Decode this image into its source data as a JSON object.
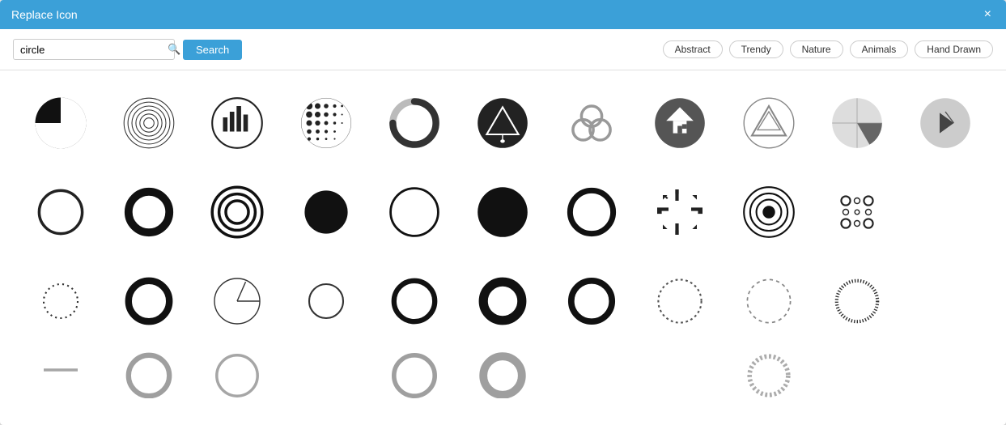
{
  "dialog": {
    "title": "Replace Icon",
    "close_label": "×"
  },
  "toolbar": {
    "search_value": "circle",
    "search_placeholder": "circle",
    "search_button_label": "Search",
    "tags": [
      "Abstract",
      "Trendy",
      "Nature",
      "Animals",
      "Hand Drawn"
    ]
  },
  "icons": {
    "rows": [
      [
        "pie-segments-circle",
        "concentric-lines-circle",
        "bar-chart-circle",
        "halftone-dots-circle",
        "arc-circle",
        "triangle-in-circle",
        "trefoil-knot-circle",
        "house-in-circle",
        "triangle-outline-in-circle",
        "sector-circle"
      ],
      [
        "thin-ring",
        "bold-ring",
        "triple-ring",
        "solid-disc",
        "outline-circle",
        "solid-circle",
        "bold-outline-circle",
        "target-crosshair",
        "bullseye",
        "dots-grid"
      ],
      [
        "dotted-small-circle",
        "medium-bold-ring",
        "pie-slice-circle",
        "small-outline-circle",
        "medium-ring",
        "heavy-ring",
        "bold-thin-outline",
        "dotted-ring",
        "dashed-ring",
        "sketchy-ring"
      ]
    ]
  }
}
